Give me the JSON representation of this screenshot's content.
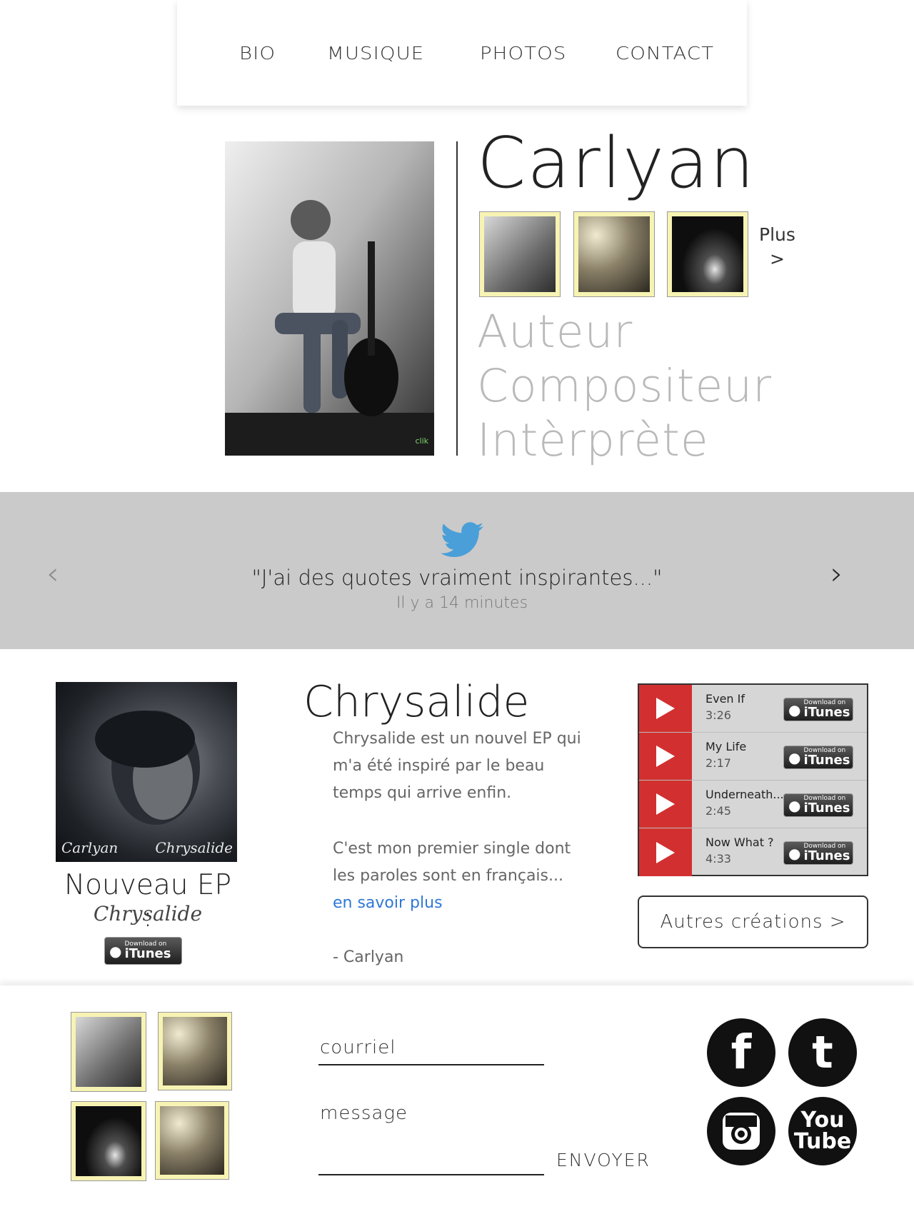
{
  "nav": {
    "items": [
      "BIO",
      "MUSIQUE",
      "PHOTOS",
      "CONTACT"
    ]
  },
  "hero": {
    "name": "Carlyan",
    "plus": "Plus",
    "plus_arrow": ">",
    "roles": [
      "Auteur",
      "Compositeur",
      "Intèrprète"
    ],
    "photo_watermark": "clik"
  },
  "tweet": {
    "quote": "\"J'ai des quotes vraiment inspirantes...\"",
    "time": "Il y a 14 minutes",
    "prev_arrow": "‹",
    "next_arrow": "›"
  },
  "ep": {
    "cover_sig_left": "Carlyan",
    "cover_sig_right": "Chrysalide",
    "title": "Nouveau EP :",
    "script": "Chrysalide",
    "heading": "Chrysalide",
    "p1": "Chrysalide est un nouvel EP qui m'a été inspiré par le beau temps qui arrive enfin.",
    "p2": "C'est mon premier single dont les paroles sont en français...",
    "more": "en savoir plus",
    "signature": "- Carlyan"
  },
  "itunes": {
    "small": "Download on",
    "big": "iTunes"
  },
  "player": {
    "tracks": [
      {
        "name": "Even If",
        "duration": "3:26"
      },
      {
        "name": "My Life",
        "duration": "2:17"
      },
      {
        "name": "Underneath...",
        "duration": "2:45"
      },
      {
        "name": "Now What ?",
        "duration": "4:33"
      }
    ]
  },
  "autres": "Autres créations  >",
  "footer": {
    "email_placeholder": "courriel",
    "message_placeholder": "message",
    "send": "ENVOYER",
    "social": [
      "facebook-icon",
      "twitter-icon",
      "instagram-icon",
      "youtube-icon"
    ],
    "youtube_top": "You",
    "youtube_bottom": "Tube"
  },
  "colors": {
    "band": "#cacaca",
    "accent_red": "#d23030",
    "link_blue": "#2f78d6",
    "thumb_frame": "#f7f3b3",
    "twitter_blue": "#4a9fd8"
  }
}
